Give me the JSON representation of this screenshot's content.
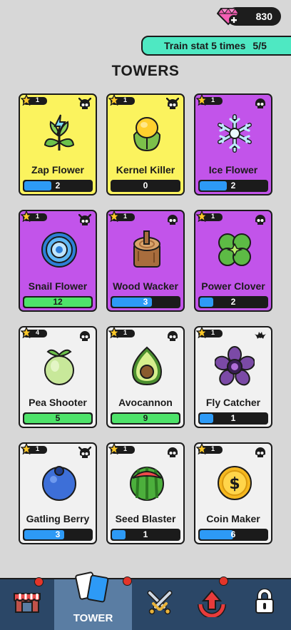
{
  "currency": {
    "gems": "830",
    "icon": "pink-gem-plus-icon"
  },
  "quest": {
    "label": "Train stat 5 times",
    "progress": "5/5"
  },
  "title": "TOWERS",
  "cards": [
    {
      "name": "Zap Flower",
      "level": "1",
      "count": "2",
      "progress": 0.4,
      "color": "yellow",
      "badge": "demon-skull-icon",
      "icon": "zap-flower-icon"
    },
    {
      "name": "Kernel Killer",
      "level": "1",
      "count": "0",
      "progress": 0,
      "color": "yellow",
      "badge": "demon-skull-icon",
      "icon": "corn-kernel-icon"
    },
    {
      "name": "Ice Flower",
      "level": "1",
      "count": "2",
      "progress": 0.4,
      "color": "purple",
      "badge": "skull-icon",
      "icon": "snowflake-icon"
    },
    {
      "name": "Snail Flower",
      "level": "1",
      "count": "12",
      "progress": 1,
      "color": "purple",
      "badge": "demon-skull-icon",
      "icon": "snail-flower-icon"
    },
    {
      "name": "Wood Wacker",
      "level": "1",
      "count": "3",
      "progress": 0.6,
      "color": "purple",
      "badge": "skull-icon",
      "icon": "wood-log-icon"
    },
    {
      "name": "Power Clover",
      "level": "1",
      "count": "2",
      "progress": 0.2,
      "color": "purple",
      "badge": "skull-icon",
      "icon": "clover-icon"
    },
    {
      "name": "Pea Shooter",
      "level": "4",
      "count": "5",
      "progress": 1,
      "color": "white",
      "badge": "skull-icon",
      "icon": "pea-pod-icon"
    },
    {
      "name": "Avocannon",
      "level": "1",
      "count": "9",
      "progress": 1,
      "color": "white",
      "badge": "skull-icon",
      "icon": "avocado-icon"
    },
    {
      "name": "Fly Catcher",
      "level": "1",
      "count": "1",
      "progress": 0.2,
      "color": "white",
      "badge": "bat-icon",
      "icon": "purple-flower-icon"
    },
    {
      "name": "Gatling Berry",
      "level": "1",
      "count": "3",
      "progress": 0.6,
      "color": "white",
      "badge": "demon-skull-icon",
      "icon": "blueberry-icon"
    },
    {
      "name": "Seed Blaster",
      "level": "1",
      "count": "1",
      "progress": 0.2,
      "color": "white",
      "badge": "skull-icon",
      "icon": "watermelon-icon"
    },
    {
      "name": "Coin Maker",
      "level": "1",
      "count": "6",
      "progress": 0.5,
      "color": "white",
      "badge": "skull-icon",
      "icon": "gold-coin-icon"
    }
  ],
  "nav": {
    "items": [
      {
        "icon": "shop-icon",
        "label": "",
        "active": false,
        "notification": true
      },
      {
        "icon": "cards-icon",
        "label": "TOWER",
        "active": true,
        "notification": true
      },
      {
        "icon": "crossed-swords-icon",
        "label": "",
        "active": false,
        "notification": false
      },
      {
        "icon": "upgrade-arrow-icon",
        "label": "",
        "active": false,
        "notification": true
      },
      {
        "icon": "lock-icon",
        "label": "",
        "active": false,
        "notification": false
      }
    ]
  },
  "colors": {
    "yellow": "#fbf35e",
    "purple": "#c254ea",
    "white": "#f1f1f1",
    "bar_blue": "#2d9af6",
    "bar_green": "#4ee36a",
    "quest": "#4ee8c2",
    "nav": "#2b4767",
    "nav_active": "#5a7da3"
  }
}
